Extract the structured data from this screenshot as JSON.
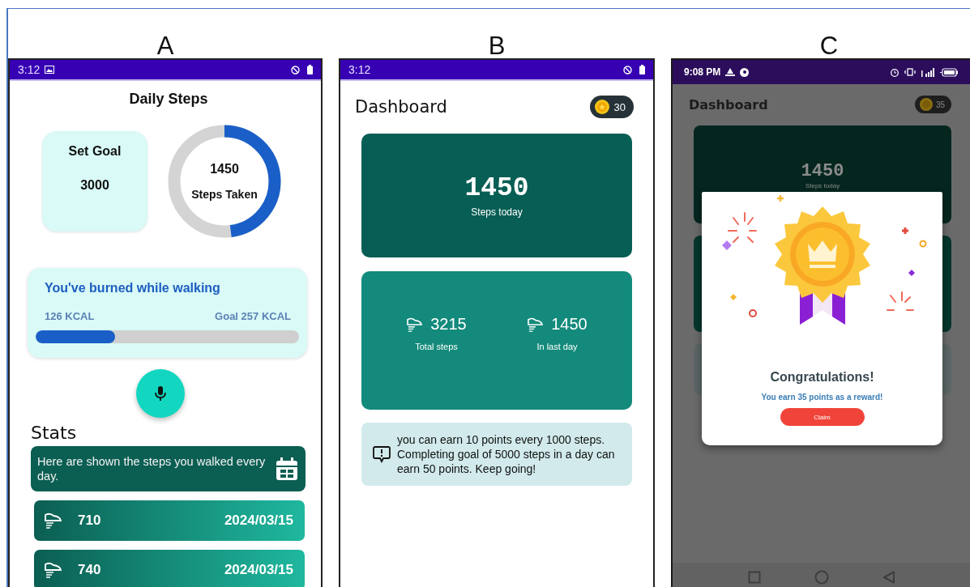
{
  "screen_a": {
    "label": "A",
    "status_bar": {
      "time": "3:12"
    },
    "title": "Daily Steps",
    "goal_card": {
      "label": "Set Goal",
      "value": "3000"
    },
    "steps_ring": {
      "value": "1450",
      "label": "Steps Taken",
      "level": 0.48
    },
    "calories_card": {
      "title": "You've burned while walking",
      "burned": "126 KCAL",
      "goal": "Goal 257 KCAL",
      "level": 0.3
    },
    "stats": {
      "title": "Stats",
      "note": "Here are shown the steps you walked every day.",
      "rows": [
        {
          "steps": "710",
          "date": "2024/03/15"
        },
        {
          "steps": "740",
          "date": "2024/03/15"
        }
      ]
    }
  },
  "screen_b": {
    "label": "B",
    "status_bar": {
      "time": "3:12"
    },
    "title": "Dashboard",
    "points": "30",
    "today": {
      "value": "1450",
      "label": "Steps today"
    },
    "summary": [
      {
        "value": "3215",
        "label": "Total steps"
      },
      {
        "value": "1450",
        "label": "In last day"
      }
    ],
    "tip": "you can earn 10 points every 1000 steps. Completing goal of 5000 steps in a day can earn 50 points. Keep going!"
  },
  "screen_c": {
    "label": "C",
    "status_bar": {
      "time": "9:08 PM"
    },
    "title": "Dashboard",
    "points": "35",
    "today": {
      "value": "1450",
      "label": "Steps today"
    },
    "dialog": {
      "title": "Congratulations!",
      "message": "You earn 35 points as a reward!",
      "button": "Claim"
    }
  }
}
